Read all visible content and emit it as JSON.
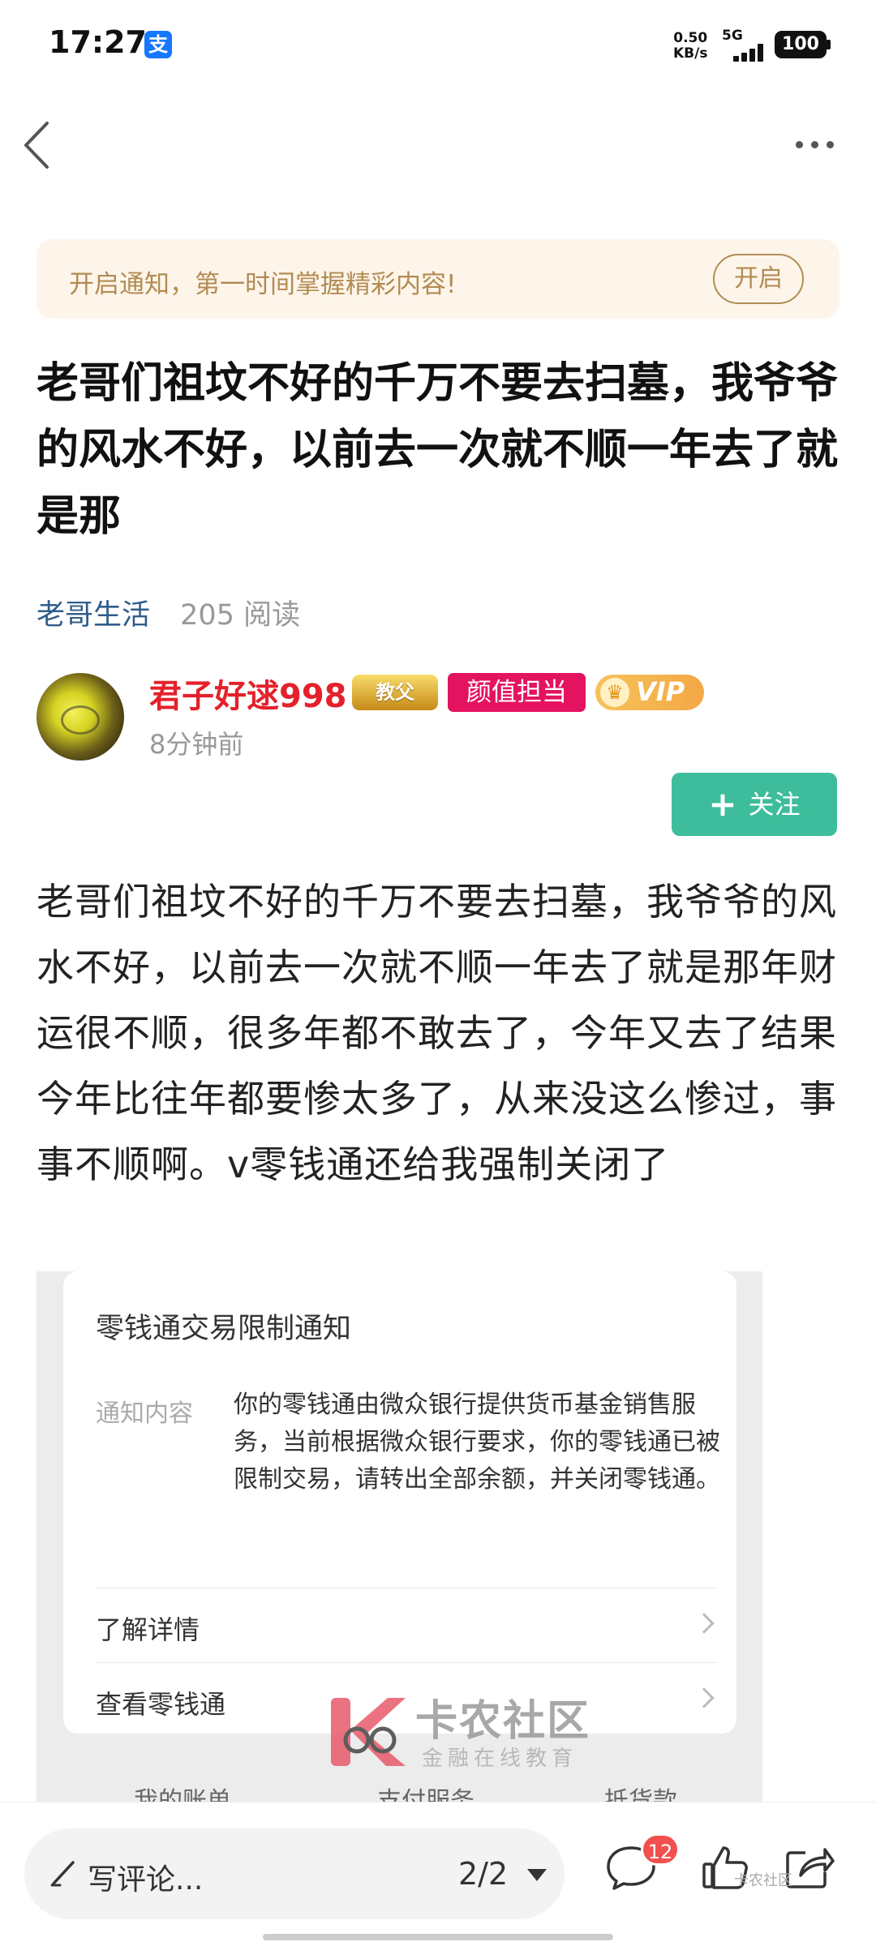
{
  "status_bar": {
    "time": "17:27",
    "app_icon": "支",
    "net_speed_value": "0.50",
    "net_speed_unit": "KB/s",
    "network": "5G",
    "battery": "100"
  },
  "notice": {
    "text": "开启通知，第一时间掌握精彩内容!",
    "button": "开启"
  },
  "post": {
    "title": "老哥们祖坟不好的千万不要去扫墓，我爷爷的风水不好，以前去一次就不顺一年去了就是那",
    "category": "老哥生活",
    "read_count": "205 阅读",
    "body": "老哥们祖坟不好的千万不要去扫墓，我爷爷的风水不好，以前去一次就不顺一年去了就是那年财运很不顺，很多年都不敢去了，今年又去了结果今年比往年都要惨太多了，从来没这么惨过，事事不顺啊。v零钱通还给我强制关闭了"
  },
  "author": {
    "name": "君子好逑998",
    "badge_teacher": "教父",
    "badge_face": "颜值担当",
    "badge_vip": "VIP",
    "time": "8分钟前",
    "follow_label": "关注"
  },
  "embedded_screenshot": {
    "title": "零钱通交易限制通知",
    "content_label": "通知内容",
    "content": "你的零钱通由微众银行提供货币基金销售服务，当前根据微众银行要求，你的零钱通已被限制交易，请转出全部余额，并关闭零钱通。",
    "rows": [
      "了解详情",
      "查看零钱通"
    ],
    "tabs": [
      "我的账单",
      "支付服务",
      "抵货款"
    ]
  },
  "watermark": {
    "title": "卡农社区",
    "subtitle": "金融在线教育",
    "small": "卡农社区"
  },
  "bottom_bar": {
    "comment_placeholder": "写评论...",
    "page_indicator": "2/2",
    "comment_count": "12"
  },
  "colors": {
    "accent_green": "#3dbd9b",
    "author_red": "#e4212b",
    "category_blue": "#2f5d8a",
    "notice_gold": "#b28b52"
  }
}
